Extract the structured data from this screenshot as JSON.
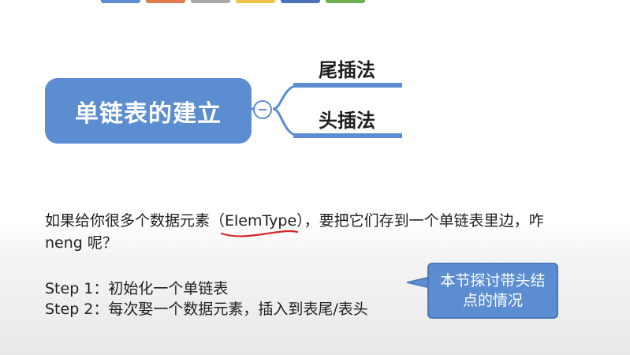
{
  "colors": {
    "accent": "#5b8dd0",
    "swatches": [
      "#5b8dd0",
      "#e07a4f",
      "#a9a9a9",
      "#f0c24b",
      "#4a72b8",
      "#6fb04f"
    ]
  },
  "mindmap": {
    "root_label": "单链表的建立",
    "branches": [
      {
        "label": "尾插法"
      },
      {
        "label": "头插法"
      }
    ]
  },
  "question": {
    "before": "如果给你很多个数据元素（",
    "highlight": "ElemType",
    "after": "），要把它们存到一个单链表里边，咋 neng 呢？"
  },
  "steps": [
    "Step 1：初始化一个单链表",
    "Step 2：每次娶一个数据元素，插入到表尾/表头"
  ],
  "callout": {
    "text": "本节探讨带头结点的情况"
  }
}
